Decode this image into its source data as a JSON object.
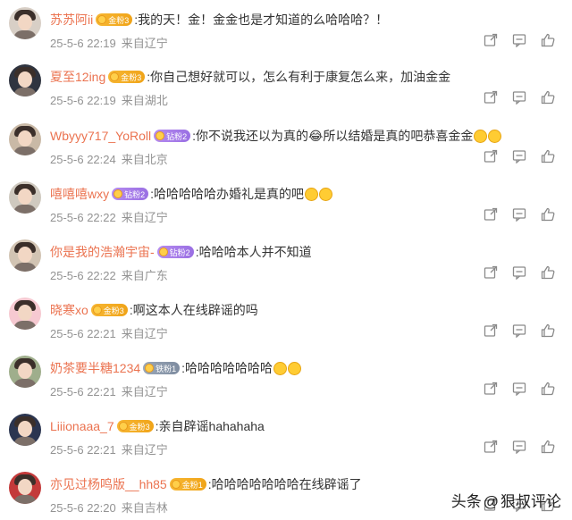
{
  "comments": [
    {
      "username": "苏苏阿ii",
      "badge": "金粉3",
      "badge_type": "gold",
      "text": ":我的天！金！金金也是才知道的么哈哈哈？！",
      "emojis": 0,
      "date": "25-5-6 22:19",
      "location": "来自辽宁",
      "avatar_bg": "#d8cfc6"
    },
    {
      "username": "夏至12ing",
      "badge": "金粉3",
      "badge_type": "gold",
      "text": ":你自己想好就可以，怎么有利于康复怎么来，加油金金",
      "emojis": 0,
      "date": "25-5-6 22:19",
      "location": "来自湖北",
      "avatar_bg": "#2f3440"
    },
    {
      "username": "Wbyyy717_YoRoll",
      "badge": "钻粉2",
      "badge_type": "diamond",
      "text": ":你不说我还以为真的😂所以结婚是真的吧恭喜金金",
      "emojis": 2,
      "date": "25-5-6 22:24",
      "location": "来自北京",
      "avatar_bg": "#c9b9a6"
    },
    {
      "username": "嘻嘻嘻wxy",
      "badge": "钻粉2",
      "badge_type": "diamond",
      "text": ":哈哈哈哈哈办婚礼是真的吧",
      "emojis": 2,
      "date": "25-5-6 22:22",
      "location": "来自辽宁",
      "avatar_bg": "#cfc9bf"
    },
    {
      "username": "你是我的浩瀚宇宙-",
      "badge": "钻粉2",
      "badge_type": "diamond",
      "text": ":哈哈哈本人并不知道",
      "emojis": 0,
      "date": "25-5-6 22:22",
      "location": "来自广东",
      "avatar_bg": "#d2c4b3"
    },
    {
      "username": "晓寒xo",
      "badge": "金粉3",
      "badge_type": "gold",
      "text": ":啊这本人在线辟谣的吗",
      "emojis": 0,
      "date": "25-5-6 22:21",
      "location": "来自辽宁",
      "avatar_bg": "#f6c9d1"
    },
    {
      "username": "奶茶要半糖1234",
      "badge": "铁粉1",
      "badge_type": "iron",
      "text": ":哈哈哈哈哈哈哈",
      "emojis": 2,
      "date": "25-5-6 22:21",
      "location": "来自辽宁",
      "avatar_bg": "#9fae8c"
    },
    {
      "username": "Liiionaaa_7",
      "badge": "金粉3",
      "badge_type": "gold",
      "text": ":亲自辟谣hahahaha",
      "emojis": 0,
      "date": "25-5-6 22:21",
      "location": "来自辽宁",
      "avatar_bg": "#2b3550"
    },
    {
      "username": "亦见过杨鸣版__hh85",
      "badge": "金粉1",
      "badge_type": "gold",
      "text": ":哈哈哈哈哈哈哈在线辟谣了",
      "emojis": 0,
      "date": "25-5-6 22:20",
      "location": "来自吉林",
      "avatar_bg": "#c33a3a"
    }
  ],
  "actions": [
    "share-icon",
    "comment-icon",
    "like-icon"
  ],
  "watermark": {
    "source": "头条",
    "at": "@",
    "author": "狠叔评论"
  },
  "colors": {
    "username": "#eb7350",
    "meta": "#939393",
    "text": "#333333",
    "icon": "#8a8a8a"
  }
}
